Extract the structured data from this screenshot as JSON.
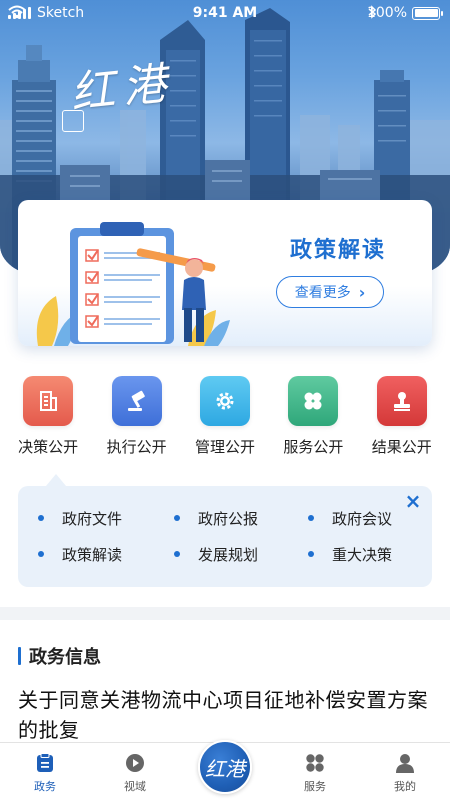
{
  "status_bar": {
    "carrier": "Sketch",
    "time": "9:41 AM",
    "battery": "100%",
    "battery_level": 1.0
  },
  "hero": {
    "logo_text": "红港",
    "logo_icon": "calligraphy-logo"
  },
  "policy_card": {
    "title": "政策解读",
    "more_label": "查看更多",
    "more_icon": "chevron-right-icon"
  },
  "categories": [
    {
      "label": "决策公开",
      "icon": "building-icon",
      "color": "#ef6b5b"
    },
    {
      "label": "执行公开",
      "icon": "gavel-icon",
      "color": "#4a7de3"
    },
    {
      "label": "管理公开",
      "icon": "gear-icon",
      "color": "#3fb6e8"
    },
    {
      "label": "服务公开",
      "icon": "clover-icon",
      "color": "#3bb58a"
    },
    {
      "label": "结果公开",
      "icon": "stamp-icon",
      "color": "#e04848"
    }
  ],
  "submenu": {
    "items": [
      "政府文件",
      "政府公报",
      "政府会议",
      "政策解读",
      "发展规划",
      "重大决策"
    ],
    "close_icon": "close-icon"
  },
  "news": {
    "section_title": "政务信息",
    "headline": "关于同意关港物流中心项目征地补偿安置方案的批复"
  },
  "tabbar": {
    "tabs": [
      {
        "label": "政务",
        "icon": "document-icon",
        "active": true
      },
      {
        "label": "视域",
        "icon": "play-icon",
        "active": false
      },
      {
        "label": "",
        "icon": "center-logo-icon",
        "active": false
      },
      {
        "label": "服务",
        "icon": "grid-icon",
        "active": false
      },
      {
        "label": "我的",
        "icon": "user-icon",
        "active": false
      }
    ],
    "center_text": "红港"
  },
  "colors": {
    "primary": "#1e6fd0",
    "panel_bg": "#e9f1fa",
    "tab_active": "#1e5fb8"
  }
}
